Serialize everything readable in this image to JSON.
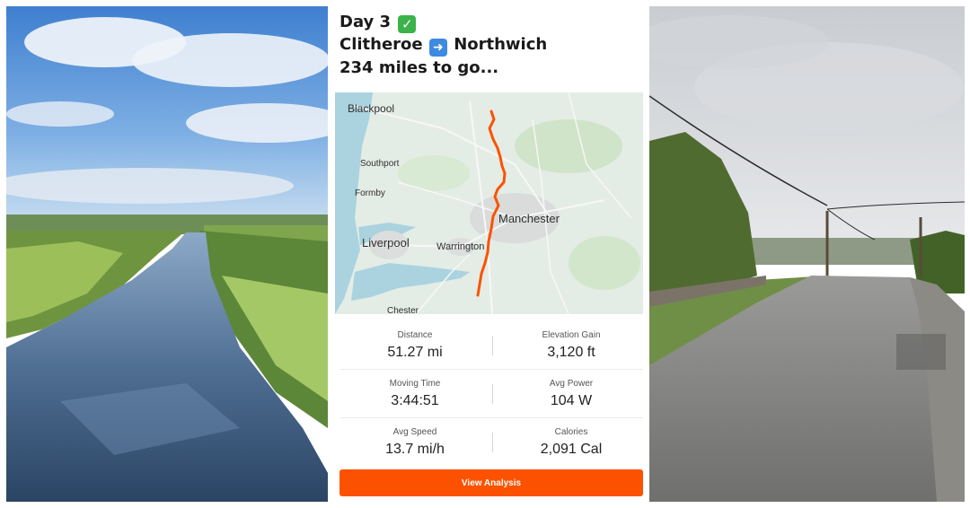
{
  "activity": {
    "day_label": "Day 3",
    "check_icon": "check-mark-button",
    "from": "Clitheroe",
    "arrow_icon": "right-arrow-emoji",
    "to": "Northwich",
    "remaining": "234 miles to go..."
  },
  "map": {
    "labels": {
      "blackpool": "Blackpool",
      "southport": "Southport",
      "formby": "Formby",
      "manchester": "Manchester",
      "liverpool": "Liverpool",
      "warrington": "Warrington",
      "chester": "Chester"
    },
    "route_color": "#fc5200"
  },
  "stats": [
    {
      "label": "Distance",
      "value": "51.27 mi"
    },
    {
      "label": "Elevation Gain",
      "value": "3,120 ft"
    },
    {
      "label": "Moving Time",
      "value": "3:44:51"
    },
    {
      "label": "Avg Power",
      "value": "104 W"
    },
    {
      "label": "Avg Speed",
      "value": "13.7 mi/h"
    },
    {
      "label": "Calories",
      "value": "2,091 Cal"
    }
  ],
  "button": {
    "label": "View Analysis"
  },
  "colors": {
    "accent": "#fc5200",
    "water": "#aad3df",
    "land": "#e4ece6"
  }
}
